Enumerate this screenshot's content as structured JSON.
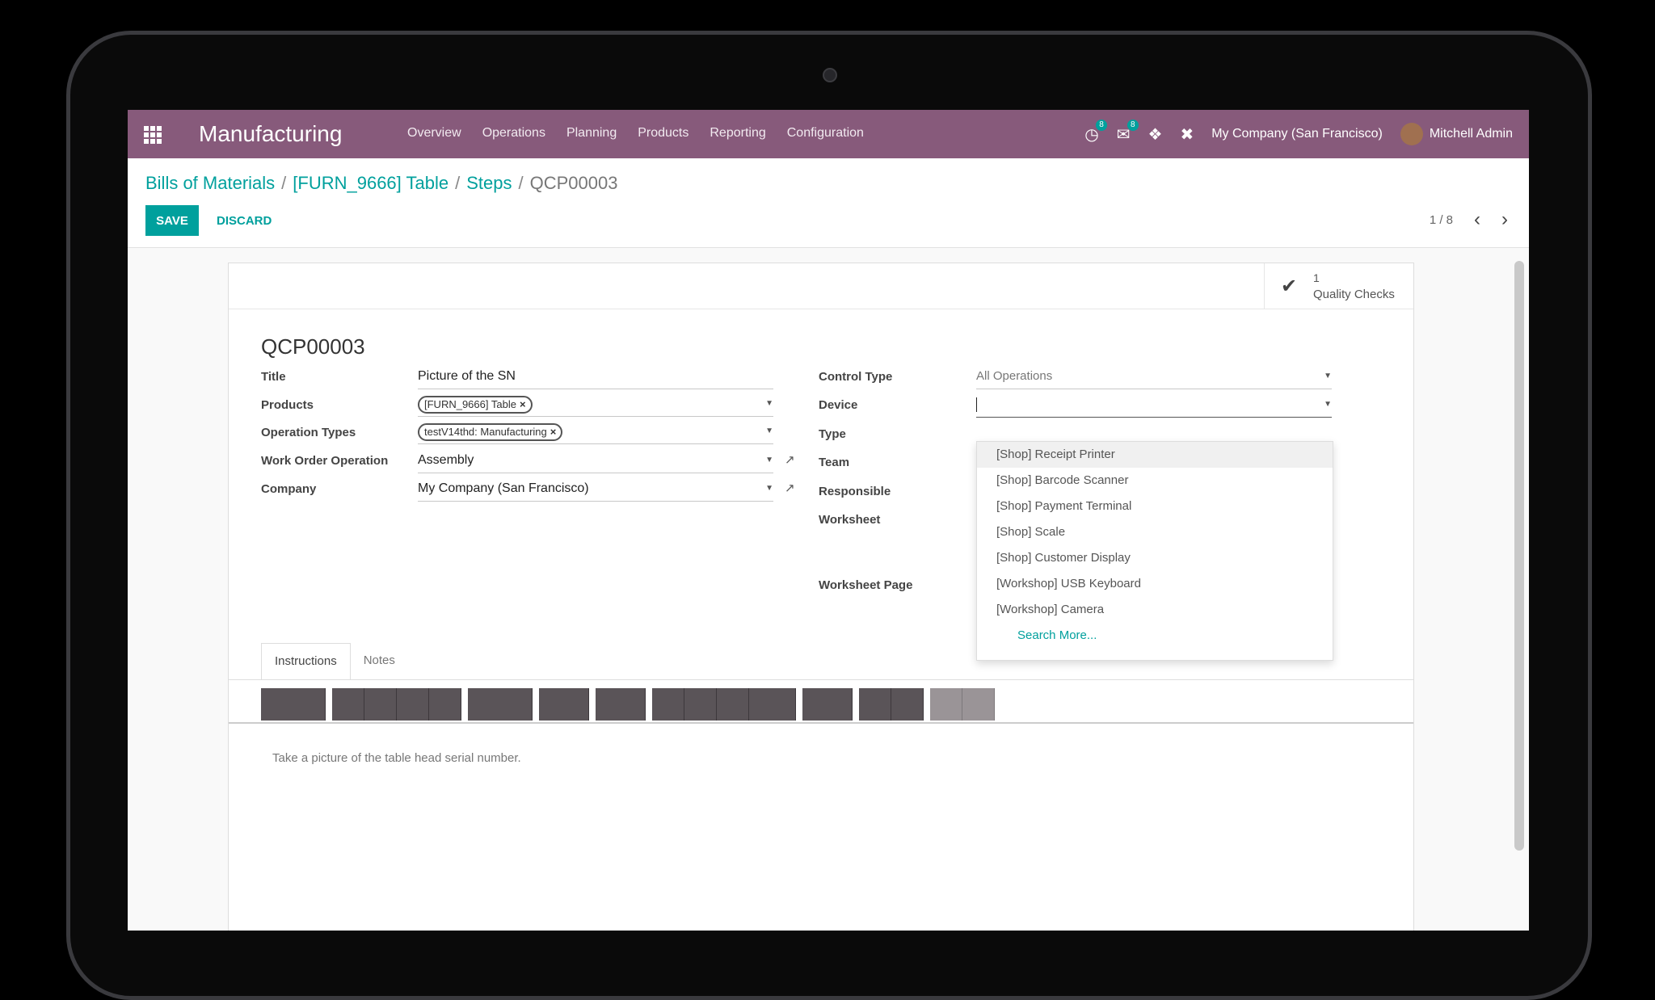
{
  "app": {
    "name": "Manufacturing",
    "menu": [
      "Overview",
      "Operations",
      "Planning",
      "Products",
      "Reporting",
      "Configuration"
    ],
    "systray": {
      "activity_badge": "8",
      "messages_badge": "8",
      "company": "My Company (San Francisco)",
      "user": "Mitchell Admin"
    },
    "brand_color": "#875a7b",
    "accent_color": "#00a09d"
  },
  "breadcrumb": {
    "items": [
      "Bills of Materials",
      "[FURN_9666] Table",
      "Steps"
    ],
    "current": "QCP00003",
    "separator": "/"
  },
  "buttons": {
    "save": "SAVE",
    "discard": "DISCARD"
  },
  "pager": {
    "value": "1 / 8"
  },
  "stat_button": {
    "value": "1",
    "label": "Quality Checks"
  },
  "record": {
    "name": "QCP00003",
    "left_fields": [
      {
        "label": "Title",
        "value": "Picture of the SN"
      },
      {
        "label": "Products",
        "tag": "[FURN_9666] Table"
      },
      {
        "label": "Operation Types",
        "tag": "testV14thd: Manufacturing"
      },
      {
        "label": "Work Order Operation",
        "value": "Assembly"
      },
      {
        "label": "Company",
        "value": "My Company (San Francisco)"
      }
    ],
    "right_fields": [
      {
        "label": "Control Type",
        "value": "All Operations"
      },
      {
        "label": "Device",
        "value": ""
      },
      {
        "label": "Type"
      },
      {
        "label": "Team"
      },
      {
        "label": "Responsible"
      },
      {
        "label": "Worksheet"
      },
      {
        "label": "Worksheet Page"
      }
    ]
  },
  "device_dropdown": {
    "options": [
      "[Shop] Receipt Printer",
      "[Shop] Barcode Scanner",
      "[Shop] Payment Terminal",
      "[Shop] Scale",
      "[Shop] Customer Display",
      "[Workshop] USB Keyboard",
      "[Workshop] Camera"
    ],
    "search_more": "Search More..."
  },
  "tabs": [
    "Instructions",
    "Notes"
  ],
  "instructions_text": "Take a picture of the table head serial number."
}
